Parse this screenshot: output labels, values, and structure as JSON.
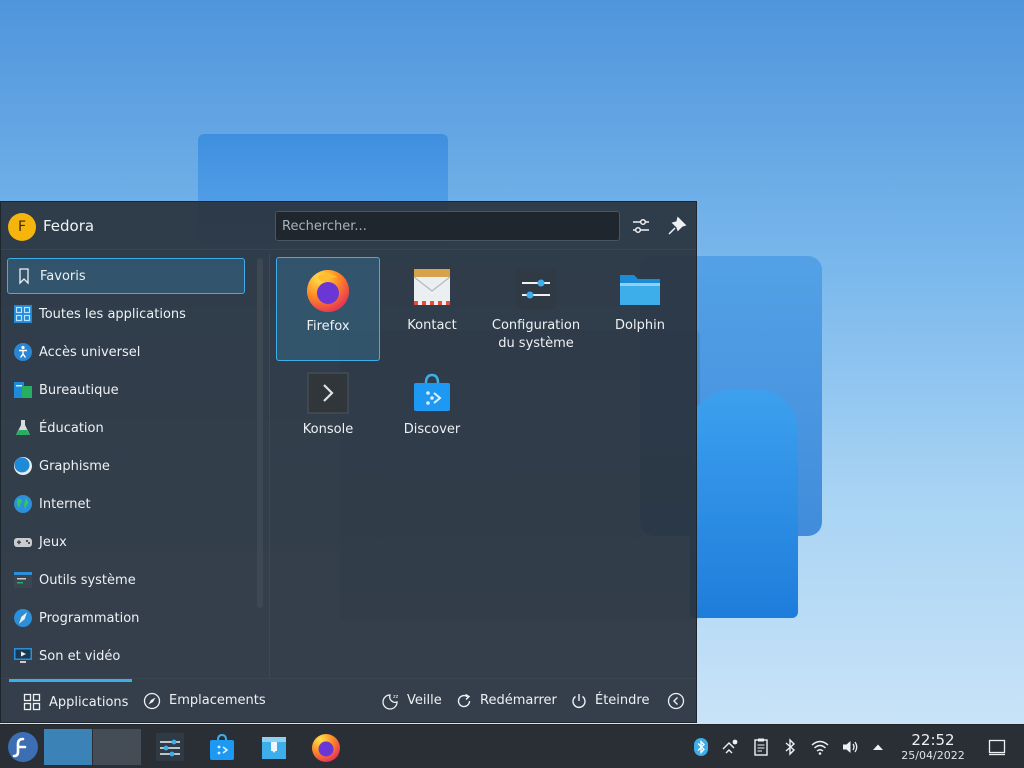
{
  "user": {
    "initial": "F",
    "name": "Fedora"
  },
  "search": {
    "placeholder": "Rechercher..."
  },
  "categories": [
    {
      "label": "Favoris",
      "icon": "bookmark-icon"
    },
    {
      "label": "Toutes les applications",
      "icon": "grid-icon"
    },
    {
      "label": "Accès universel",
      "icon": "accessibility-icon"
    },
    {
      "label": "Bureautique",
      "icon": "office-icon"
    },
    {
      "label": "Éducation",
      "icon": "flask-icon"
    },
    {
      "label": "Graphisme",
      "icon": "graphics-icon"
    },
    {
      "label": "Internet",
      "icon": "globe-icon"
    },
    {
      "label": "Jeux",
      "icon": "gamepad-icon"
    },
    {
      "label": "Outils système",
      "icon": "system-tools-icon"
    },
    {
      "label": "Programmation",
      "icon": "compass-icon"
    },
    {
      "label": "Son et vidéo",
      "icon": "monitor-icon"
    }
  ],
  "apps": [
    {
      "label": "Firefox",
      "icon": "firefox-icon"
    },
    {
      "label": "Kontact",
      "icon": "kontact-icon"
    },
    {
      "label": "Configuration du système",
      "icon": "system-settings-icon"
    },
    {
      "label": "Dolphin",
      "icon": "folder-icon"
    },
    {
      "label": "Konsole",
      "icon": "terminal-icon"
    },
    {
      "label": "Discover",
      "icon": "discover-icon"
    }
  ],
  "footer": {
    "applications": "Applications",
    "places": "Emplacements",
    "sleep": "Veille",
    "restart": "Redémarrer",
    "shutdown": "Éteindre"
  },
  "clock": {
    "time": "22:52",
    "date": "25/04/2022"
  },
  "colors": {
    "accent": "#3daee9",
    "panel": "#2a333d",
    "avatar": "#f6b50d"
  }
}
